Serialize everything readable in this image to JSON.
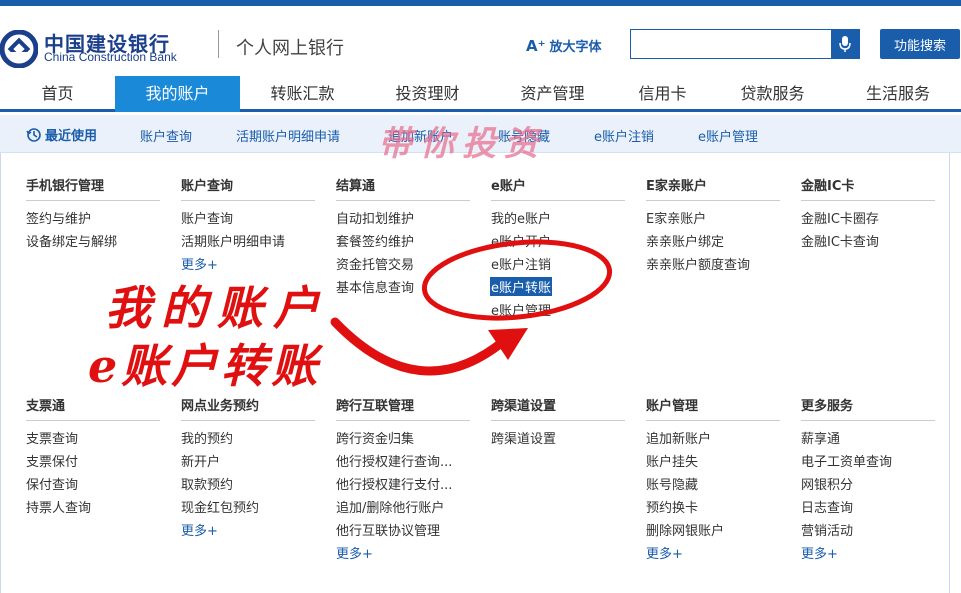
{
  "header": {
    "bank_name_cn": "中国建设银行",
    "bank_name_en": "China Construction Bank",
    "site_name": "个人网上银行",
    "enlarge_font": "放大字体",
    "enlarge_icon": "A⁺",
    "search_placeholder": "",
    "function_search": "功能搜索"
  },
  "nav": {
    "items": [
      "首页",
      "我的账户",
      "转账汇款",
      "投资理财",
      "资产管理",
      "信用卡",
      "贷款服务",
      "生活服务"
    ],
    "active": "我的账户"
  },
  "recent": {
    "label": "最近使用",
    "links": [
      "账户查询",
      "活期账户明细申请",
      "追加新账户",
      "账号隐藏",
      "e账户注销",
      "e账户管理"
    ]
  },
  "menu": {
    "row1": [
      {
        "title": "手机银行管理",
        "items": [
          "签约与维护",
          "设备绑定与解绑"
        ]
      },
      {
        "title": "账户查询",
        "items": [
          "账户查询",
          "活期账户明细申请"
        ],
        "more": "更多+"
      },
      {
        "title": "结算通",
        "items": [
          "自动扣划维护",
          "套餐签约维护",
          "资金托管交易",
          "基本信息查询"
        ]
      },
      {
        "title": "e账户",
        "items": [
          "我的e账户",
          "e账户开户",
          "e账户注销",
          "e账户转账",
          "e账户管理"
        ]
      },
      {
        "title": "E家亲账户",
        "items": [
          "E家亲账户",
          "亲亲账户绑定",
          "亲亲账户额度查询"
        ]
      },
      {
        "title": "金融IC卡",
        "items": [
          "金融IC卡圈存",
          "金融IC卡查询"
        ]
      }
    ],
    "row2": [
      {
        "title": "支票通",
        "items": [
          "支票查询",
          "支票保付",
          "保付查询",
          "持票人查询"
        ]
      },
      {
        "title": "网点业务预约",
        "items": [
          "我的预约",
          "新开户",
          "取款预约",
          "现金红包预约"
        ],
        "more": "更多+"
      },
      {
        "title": "跨行互联管理",
        "items": [
          "跨行资金归集",
          "他行授权建行查询...",
          "他行授权建行支付...",
          "追加/删除他行账户",
          "他行互联协议管理"
        ],
        "more": "更多+"
      },
      {
        "title": "跨渠道设置",
        "items": [
          "跨渠道设置"
        ]
      },
      {
        "title": "账户管理",
        "items": [
          "追加新账户",
          "账户挂失",
          "账号隐藏",
          "预约换卡",
          "删除网银账户"
        ],
        "more": "更多+"
      },
      {
        "title": "更多服务",
        "items": [
          "薪享通",
          "电子工资单查询",
          "网银积分",
          "日志查询",
          "营销活动"
        ],
        "more": "更多+"
      }
    ],
    "highlighted_item": "e账户转账"
  },
  "annotation": {
    "watermark": "带你投资",
    "line1": "我的账户",
    "line2": "e账户转账"
  },
  "colors": {
    "brand_blue": "#1a5dab",
    "nav_active": "#1a8ad8",
    "annotation_red": "#e01010"
  }
}
